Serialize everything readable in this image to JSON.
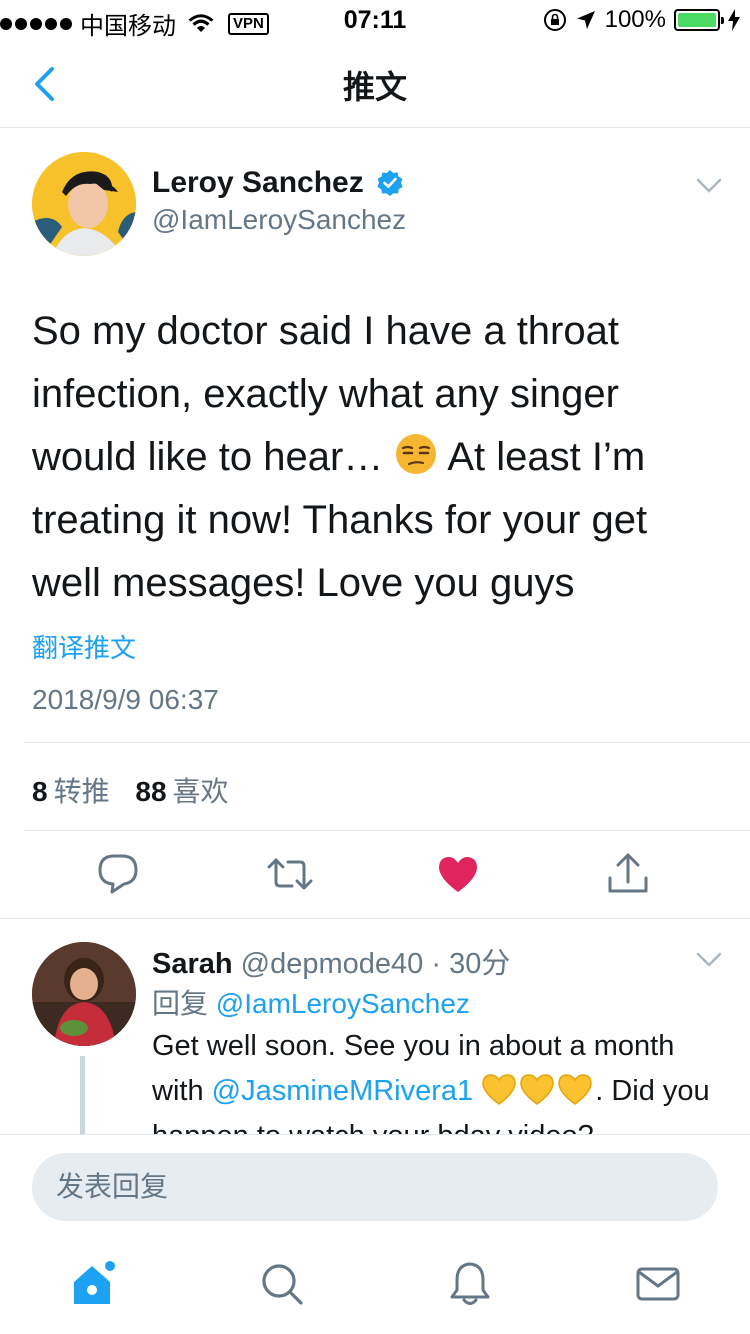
{
  "status_bar": {
    "carrier": "中国移动",
    "vpn": "VPN",
    "time": "07:11",
    "battery": "100%"
  },
  "nav": {
    "title": "推文"
  },
  "tweet": {
    "author_name": "Leroy Sanchez",
    "author_handle": "@IamLeroySanchez",
    "text_part1": "So my doctor said I have a throat infection, exactly what any singer would like to hear… ",
    "text_part2": " At least I’m treating it now! Thanks for your get well messages! Love you guys",
    "translate_label": "翻译推文",
    "timestamp": "2018/9/9 06:37",
    "retweets_count": "8",
    "retweets_label": "转推",
    "likes_count": "88",
    "likes_label": "喜欢"
  },
  "reply": {
    "name": "Sarah",
    "handle": "@depmode40",
    "separator": "·",
    "time": "30分",
    "replying_label": "回复",
    "replying_to": "@IamLeroySanchez",
    "text_part1": "Get well soon. See you in about a month with ",
    "mention": "@JasmineMRivera1",
    "text_part2": ". Did you happen to watch your bday video?"
  },
  "compose": {
    "placeholder": "发表回复"
  },
  "colors": {
    "accent": "#1da1f2",
    "like_active": "#e0245e",
    "muted": "#657786"
  },
  "icons": {
    "back": "chevron-left-icon",
    "verified": "verified-badge-icon",
    "caret": "chevron-down-icon",
    "reply": "reply-bubble-icon",
    "retweet": "retweet-icon",
    "like": "heart-icon",
    "share": "share-icon",
    "home": "home-icon",
    "search": "search-icon",
    "notifications": "bell-icon",
    "messages": "mail-icon"
  }
}
